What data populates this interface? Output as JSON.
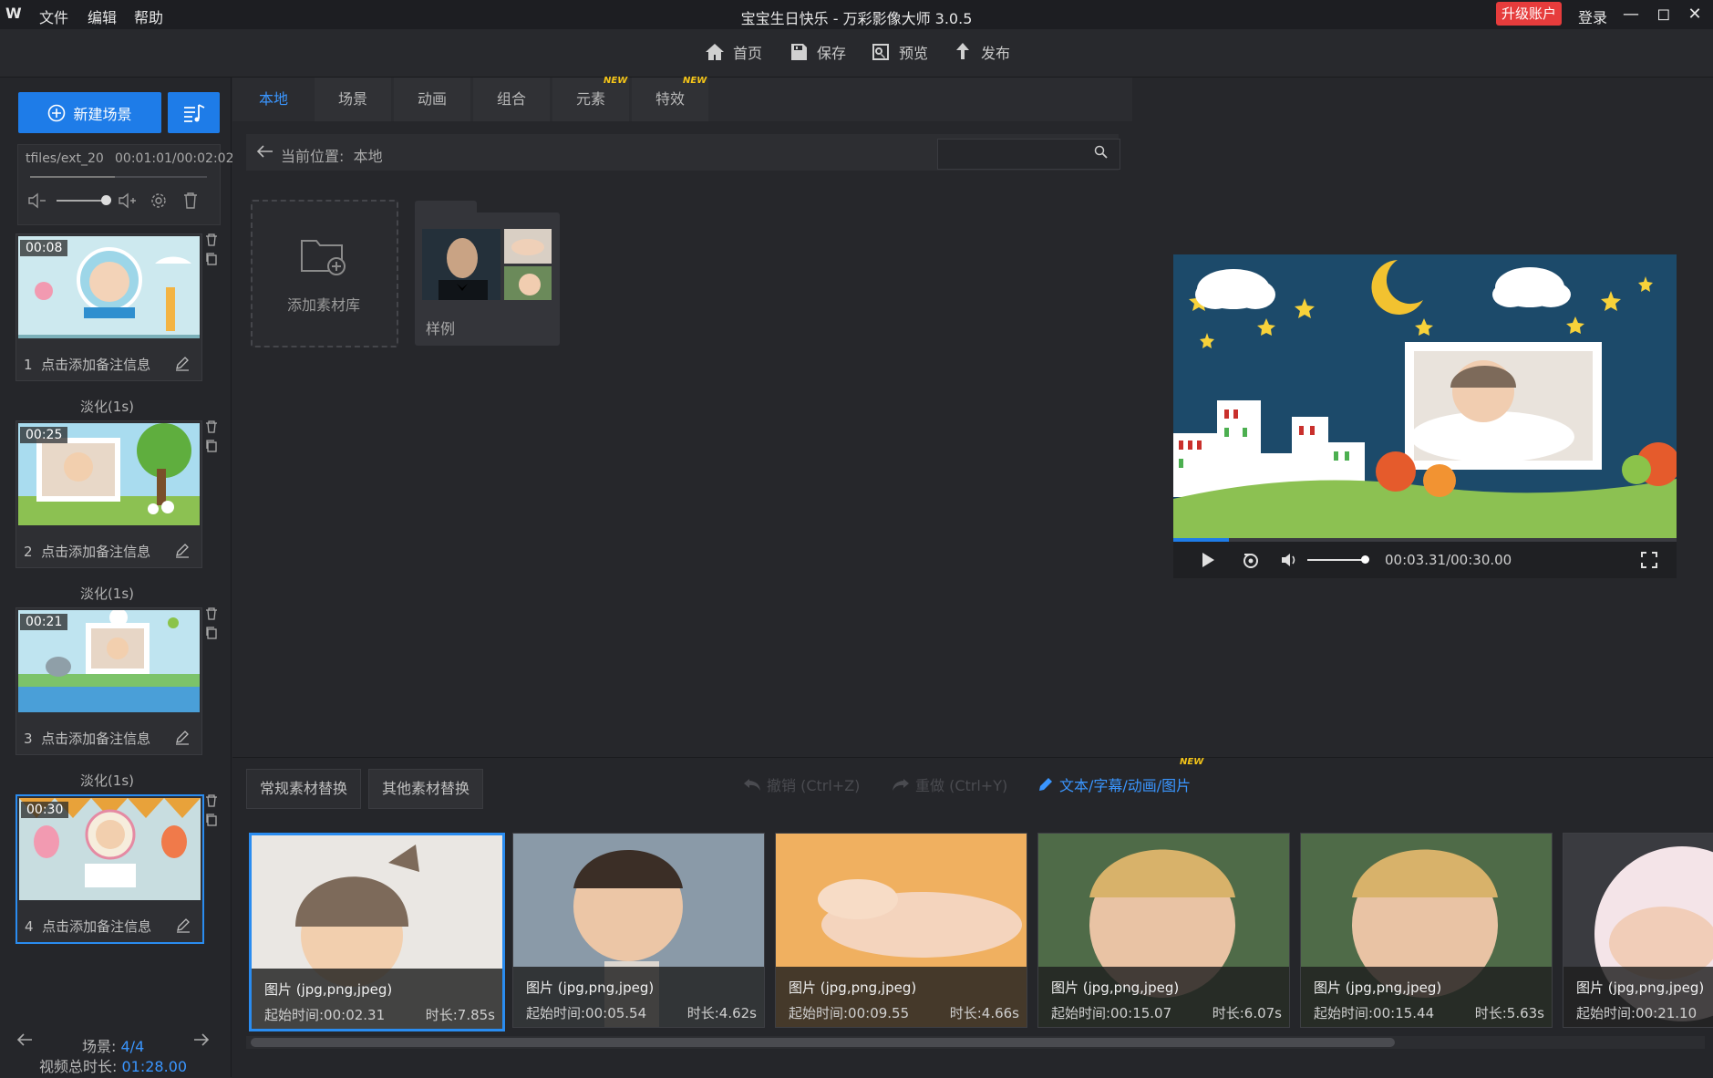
{
  "titlebar": {
    "logo": "W",
    "menu": [
      "文件",
      "编辑",
      "帮助"
    ],
    "title": "宝宝生日快乐 - 万彩影像大师 3.0.5",
    "upgrade": "升级账户",
    "login": "登录"
  },
  "toolbar": {
    "home": "首页",
    "save": "保存",
    "preview": "预览",
    "publish": "发布"
  },
  "left": {
    "new_scene": "新建场景",
    "music_name": "tfiles/ext_20",
    "music_time": "00:01:01/00:02:02",
    "music_progress": 0.48,
    "scenes": [
      {
        "time": "00:08",
        "index": "1",
        "note": "点击添加备注信息"
      },
      {
        "time": "00:25",
        "index": "2",
        "note": "点击添加备注信息"
      },
      {
        "time": "00:21",
        "index": "3",
        "note": "点击添加备注信息"
      },
      {
        "time": "00:30",
        "index": "4",
        "note": "点击添加备注信息"
      }
    ],
    "transition": "淡化(1s)",
    "scene_label": "场景:",
    "scene_count": "4/4",
    "total_label": "视频总时长:",
    "total_time": "01:28.00"
  },
  "library": {
    "tabs": [
      "本地",
      "场景",
      "动画",
      "组合",
      "元素",
      "特效"
    ],
    "new_badge": "NEW",
    "path_label": "当前位置:",
    "path_value": "本地",
    "search_value": "",
    "add_library": "添加素材库",
    "sample": "样例"
  },
  "player": {
    "time": "00:03.31/00:30.00",
    "progress": 0.11,
    "volume": 0.9
  },
  "bottom": {
    "tab_normal": "常规素材替换",
    "tab_other": "其他素材替换",
    "undo": "撤销 (Ctrl+Z)",
    "redo": "重做 (Ctrl+Y)",
    "text_edit": "文本/字幕/动画/图片",
    "assets": [
      {
        "type": "图片 (jpg,png,jpeg)",
        "start": "起始时间:00:02.31",
        "duration": "时长:7.85s"
      },
      {
        "type": "图片 (jpg,png,jpeg)",
        "start": "起始时间:00:05.54",
        "duration": "时长:4.62s"
      },
      {
        "type": "图片 (jpg,png,jpeg)",
        "start": "起始时间:00:09.55",
        "duration": "时长:4.66s"
      },
      {
        "type": "图片 (jpg,png,jpeg)",
        "start": "起始时间:00:15.07",
        "duration": "时长:6.07s"
      },
      {
        "type": "图片 (jpg,png,jpeg)",
        "start": "起始时间:00:15.44",
        "duration": "时长:5.63s"
      },
      {
        "type": "图片 (jpg,png,jpeg)",
        "start": "起始时间:00:21.10",
        "duration": ""
      }
    ]
  },
  "colors": {
    "accent": "#1e7ce8",
    "highlight": "#3a96ff",
    "upgrade": "#e63c3c",
    "new_badge": "#f5c518"
  }
}
